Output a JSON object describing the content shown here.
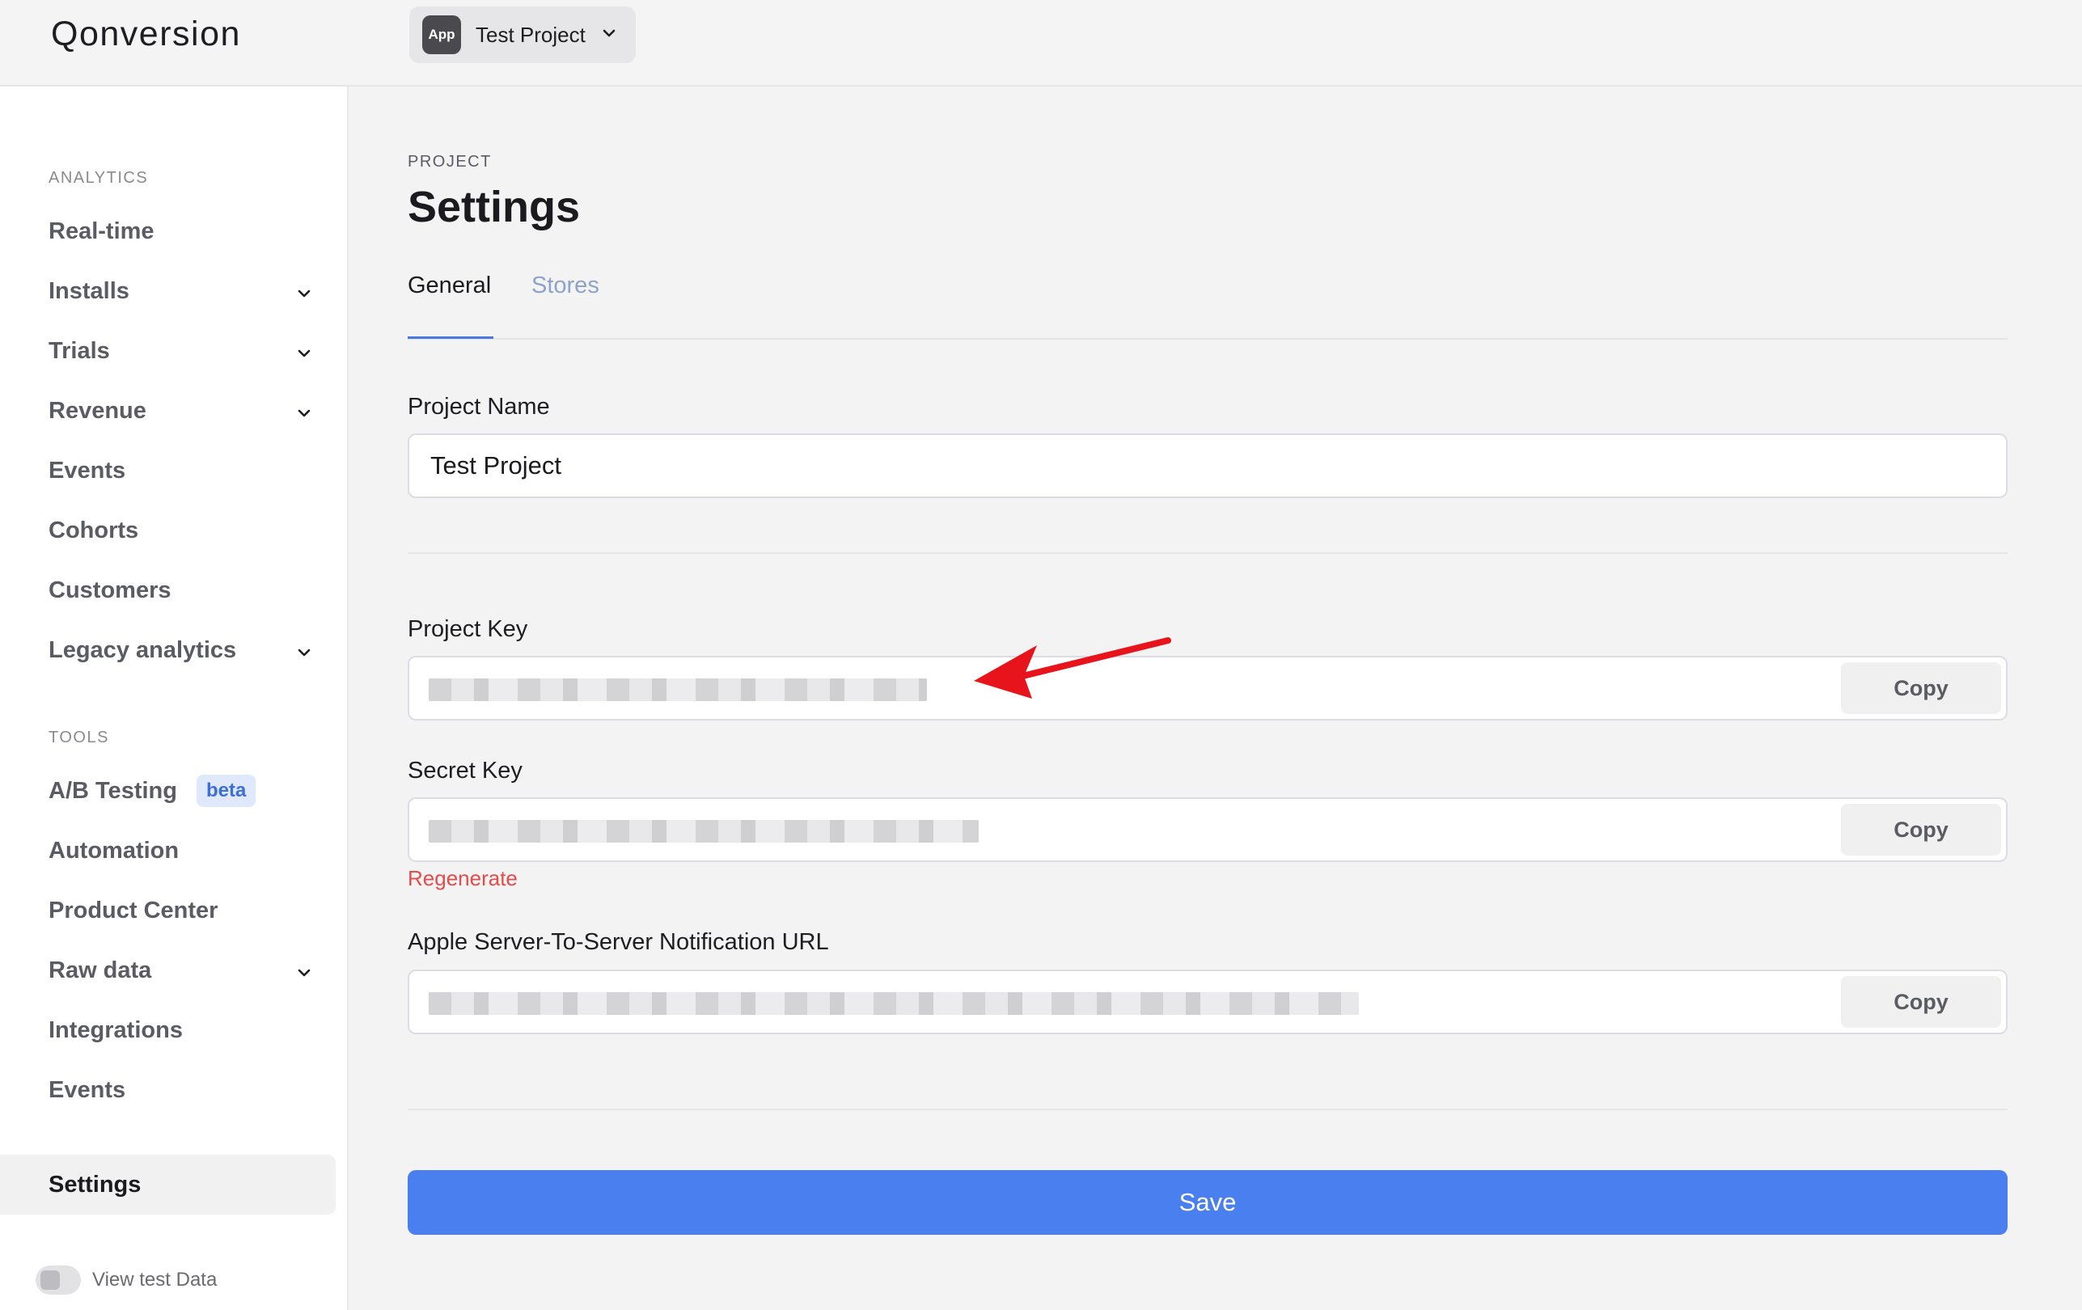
{
  "header": {
    "logo": "Qonversion",
    "project_badge": "App",
    "project_name": "Test Project"
  },
  "sidebar": {
    "analytics_label": "ANALYTICS",
    "analytics_items": [
      {
        "label": "Real-time",
        "expandable": false
      },
      {
        "label": "Installs",
        "expandable": true
      },
      {
        "label": "Trials",
        "expandable": true
      },
      {
        "label": "Revenue",
        "expandable": true
      },
      {
        "label": "Events",
        "expandable": false
      },
      {
        "label": "Cohorts",
        "expandable": false
      },
      {
        "label": "Customers",
        "expandable": false
      },
      {
        "label": "Legacy analytics",
        "expandable": true
      }
    ],
    "tools_label": "TOOLS",
    "tools_items": [
      {
        "label": "A/B Testing",
        "badge": "beta"
      },
      {
        "label": "Automation"
      },
      {
        "label": "Product Center"
      },
      {
        "label": "Raw data",
        "expandable": true
      },
      {
        "label": "Integrations"
      },
      {
        "label": "Events"
      }
    ],
    "settings_label": "Settings",
    "view_test_data_label": "View test Data"
  },
  "main": {
    "breadcrumb": "PROJECT",
    "title": "Settings",
    "tabs": [
      {
        "label": "General",
        "active": true
      },
      {
        "label": "Stores",
        "active": false
      }
    ],
    "project_name_label": "Project Name",
    "project_name_value": "Test Project",
    "project_key_label": "Project Key",
    "secret_key_label": "Secret Key",
    "regenerate_label": "Regenerate",
    "apple_url_label": "Apple Server-To-Server Notification URL",
    "copy_label": "Copy",
    "save_label": "Save"
  },
  "colors": {
    "accent": "#4a7ff0",
    "danger": "#e24c4c",
    "beta_bg": "#dfe9fb",
    "arrow": "#e8141b"
  }
}
